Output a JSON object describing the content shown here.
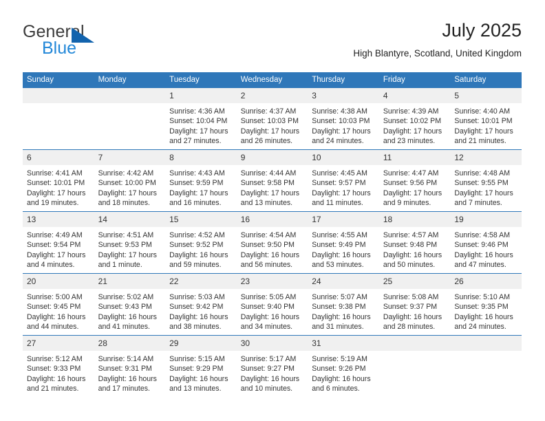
{
  "logo": {
    "word_top": "General",
    "word_bottom": "Blue",
    "triangle_color": "#1263ad",
    "blue_color": "#2287d8",
    "gray_color": "#3b3b3b"
  },
  "header": {
    "title": "July 2025",
    "subtitle": "High Blantyre, Scotland, United Kingdom",
    "header_bg": "#2f77b9",
    "daynum_bg": "#f0f0f0",
    "grid_line": "#2f77b9"
  },
  "weekday_headers": [
    "Sunday",
    "Monday",
    "Tuesday",
    "Wednesday",
    "Thursday",
    "Friday",
    "Saturday"
  ],
  "weeks": [
    {
      "days": [
        {
          "num": "",
          "empty": true,
          "sunrise": "",
          "sunset": "",
          "daylight_1": "",
          "daylight_2": ""
        },
        {
          "num": "",
          "empty": true,
          "sunrise": "",
          "sunset": "",
          "daylight_1": "",
          "daylight_2": ""
        },
        {
          "num": "1",
          "empty": false,
          "sunrise": "Sunrise: 4:36 AM",
          "sunset": "Sunset: 10:04 PM",
          "daylight_1": "Daylight: 17 hours",
          "daylight_2": "and 27 minutes."
        },
        {
          "num": "2",
          "empty": false,
          "sunrise": "Sunrise: 4:37 AM",
          "sunset": "Sunset: 10:03 PM",
          "daylight_1": "Daylight: 17 hours",
          "daylight_2": "and 26 minutes."
        },
        {
          "num": "3",
          "empty": false,
          "sunrise": "Sunrise: 4:38 AM",
          "sunset": "Sunset: 10:03 PM",
          "daylight_1": "Daylight: 17 hours",
          "daylight_2": "and 24 minutes."
        },
        {
          "num": "4",
          "empty": false,
          "sunrise": "Sunrise: 4:39 AM",
          "sunset": "Sunset: 10:02 PM",
          "daylight_1": "Daylight: 17 hours",
          "daylight_2": "and 23 minutes."
        },
        {
          "num": "5",
          "empty": false,
          "sunrise": "Sunrise: 4:40 AM",
          "sunset": "Sunset: 10:01 PM",
          "daylight_1": "Daylight: 17 hours",
          "daylight_2": "and 21 minutes."
        }
      ]
    },
    {
      "days": [
        {
          "num": "6",
          "empty": false,
          "sunrise": "Sunrise: 4:41 AM",
          "sunset": "Sunset: 10:01 PM",
          "daylight_1": "Daylight: 17 hours",
          "daylight_2": "and 19 minutes."
        },
        {
          "num": "7",
          "empty": false,
          "sunrise": "Sunrise: 4:42 AM",
          "sunset": "Sunset: 10:00 PM",
          "daylight_1": "Daylight: 17 hours",
          "daylight_2": "and 18 minutes."
        },
        {
          "num": "8",
          "empty": false,
          "sunrise": "Sunrise: 4:43 AM",
          "sunset": "Sunset: 9:59 PM",
          "daylight_1": "Daylight: 17 hours",
          "daylight_2": "and 16 minutes."
        },
        {
          "num": "9",
          "empty": false,
          "sunrise": "Sunrise: 4:44 AM",
          "sunset": "Sunset: 9:58 PM",
          "daylight_1": "Daylight: 17 hours",
          "daylight_2": "and 13 minutes."
        },
        {
          "num": "10",
          "empty": false,
          "sunrise": "Sunrise: 4:45 AM",
          "sunset": "Sunset: 9:57 PM",
          "daylight_1": "Daylight: 17 hours",
          "daylight_2": "and 11 minutes."
        },
        {
          "num": "11",
          "empty": false,
          "sunrise": "Sunrise: 4:47 AM",
          "sunset": "Sunset: 9:56 PM",
          "daylight_1": "Daylight: 17 hours",
          "daylight_2": "and 9 minutes."
        },
        {
          "num": "12",
          "empty": false,
          "sunrise": "Sunrise: 4:48 AM",
          "sunset": "Sunset: 9:55 PM",
          "daylight_1": "Daylight: 17 hours",
          "daylight_2": "and 7 minutes."
        }
      ]
    },
    {
      "days": [
        {
          "num": "13",
          "empty": false,
          "sunrise": "Sunrise: 4:49 AM",
          "sunset": "Sunset: 9:54 PM",
          "daylight_1": "Daylight: 17 hours",
          "daylight_2": "and 4 minutes."
        },
        {
          "num": "14",
          "empty": false,
          "sunrise": "Sunrise: 4:51 AM",
          "sunset": "Sunset: 9:53 PM",
          "daylight_1": "Daylight: 17 hours",
          "daylight_2": "and 1 minute."
        },
        {
          "num": "15",
          "empty": false,
          "sunrise": "Sunrise: 4:52 AM",
          "sunset": "Sunset: 9:52 PM",
          "daylight_1": "Daylight: 16 hours",
          "daylight_2": "and 59 minutes."
        },
        {
          "num": "16",
          "empty": false,
          "sunrise": "Sunrise: 4:54 AM",
          "sunset": "Sunset: 9:50 PM",
          "daylight_1": "Daylight: 16 hours",
          "daylight_2": "and 56 minutes."
        },
        {
          "num": "17",
          "empty": false,
          "sunrise": "Sunrise: 4:55 AM",
          "sunset": "Sunset: 9:49 PM",
          "daylight_1": "Daylight: 16 hours",
          "daylight_2": "and 53 minutes."
        },
        {
          "num": "18",
          "empty": false,
          "sunrise": "Sunrise: 4:57 AM",
          "sunset": "Sunset: 9:48 PM",
          "daylight_1": "Daylight: 16 hours",
          "daylight_2": "and 50 minutes."
        },
        {
          "num": "19",
          "empty": false,
          "sunrise": "Sunrise: 4:58 AM",
          "sunset": "Sunset: 9:46 PM",
          "daylight_1": "Daylight: 16 hours",
          "daylight_2": "and 47 minutes."
        }
      ]
    },
    {
      "days": [
        {
          "num": "20",
          "empty": false,
          "sunrise": "Sunrise: 5:00 AM",
          "sunset": "Sunset: 9:45 PM",
          "daylight_1": "Daylight: 16 hours",
          "daylight_2": "and 44 minutes."
        },
        {
          "num": "21",
          "empty": false,
          "sunrise": "Sunrise: 5:02 AM",
          "sunset": "Sunset: 9:43 PM",
          "daylight_1": "Daylight: 16 hours",
          "daylight_2": "and 41 minutes."
        },
        {
          "num": "22",
          "empty": false,
          "sunrise": "Sunrise: 5:03 AM",
          "sunset": "Sunset: 9:42 PM",
          "daylight_1": "Daylight: 16 hours",
          "daylight_2": "and 38 minutes."
        },
        {
          "num": "23",
          "empty": false,
          "sunrise": "Sunrise: 5:05 AM",
          "sunset": "Sunset: 9:40 PM",
          "daylight_1": "Daylight: 16 hours",
          "daylight_2": "and 34 minutes."
        },
        {
          "num": "24",
          "empty": false,
          "sunrise": "Sunrise: 5:07 AM",
          "sunset": "Sunset: 9:38 PM",
          "daylight_1": "Daylight: 16 hours",
          "daylight_2": "and 31 minutes."
        },
        {
          "num": "25",
          "empty": false,
          "sunrise": "Sunrise: 5:08 AM",
          "sunset": "Sunset: 9:37 PM",
          "daylight_1": "Daylight: 16 hours",
          "daylight_2": "and 28 minutes."
        },
        {
          "num": "26",
          "empty": false,
          "sunrise": "Sunrise: 5:10 AM",
          "sunset": "Sunset: 9:35 PM",
          "daylight_1": "Daylight: 16 hours",
          "daylight_2": "and 24 minutes."
        }
      ]
    },
    {
      "days": [
        {
          "num": "27",
          "empty": false,
          "sunrise": "Sunrise: 5:12 AM",
          "sunset": "Sunset: 9:33 PM",
          "daylight_1": "Daylight: 16 hours",
          "daylight_2": "and 21 minutes."
        },
        {
          "num": "28",
          "empty": false,
          "sunrise": "Sunrise: 5:14 AM",
          "sunset": "Sunset: 9:31 PM",
          "daylight_1": "Daylight: 16 hours",
          "daylight_2": "and 17 minutes."
        },
        {
          "num": "29",
          "empty": false,
          "sunrise": "Sunrise: 5:15 AM",
          "sunset": "Sunset: 9:29 PM",
          "daylight_1": "Daylight: 16 hours",
          "daylight_2": "and 13 minutes."
        },
        {
          "num": "30",
          "empty": false,
          "sunrise": "Sunrise: 5:17 AM",
          "sunset": "Sunset: 9:27 PM",
          "daylight_1": "Daylight: 16 hours",
          "daylight_2": "and 10 minutes."
        },
        {
          "num": "31",
          "empty": false,
          "sunrise": "Sunrise: 5:19 AM",
          "sunset": "Sunset: 9:26 PM",
          "daylight_1": "Daylight: 16 hours",
          "daylight_2": "and 6 minutes."
        },
        {
          "num": "",
          "empty": true,
          "sunrise": "",
          "sunset": "",
          "daylight_1": "",
          "daylight_2": ""
        },
        {
          "num": "",
          "empty": true,
          "sunrise": "",
          "sunset": "",
          "daylight_1": "",
          "daylight_2": ""
        }
      ]
    }
  ]
}
